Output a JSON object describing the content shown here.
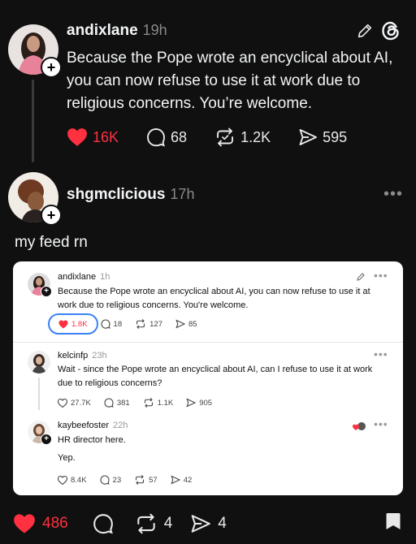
{
  "post1": {
    "username": "andixlane",
    "time": "19h",
    "text": "Because the Pope wrote an encyclical about AI, you can now refuse to use it at work due to religious concerns. You’re welcome.",
    "likes": "16K",
    "replies": "68",
    "reposts": "1.2K",
    "shares": "595"
  },
  "post2": {
    "username": "shgmclicious",
    "time": "17h",
    "text": "my feed rn"
  },
  "embed": {
    "post_a": {
      "username": "andixlane",
      "time": "1h",
      "text": "Because the Pope wrote an encyclical about AI, you can now refuse to use it at work due to religious concerns. You're welcome.",
      "likes": "1.8K",
      "replies": "18",
      "reposts": "127",
      "shares": "85"
    },
    "post_b": {
      "username": "kelcinfp",
      "time": "23h",
      "text": "Wait - since the Pope wrote an encyclical about AI, can I refuse to use it at work due to religious concerns?",
      "likes": "27.7K",
      "replies": "381",
      "reposts": "1.1K",
      "shares": "905"
    },
    "post_c": {
      "username": "kaybeefoster",
      "time": "22h",
      "line1": "HR director here.",
      "line2": "Yep.",
      "likes": "8.4K",
      "replies": "23",
      "reposts": "57",
      "shares": "42"
    }
  },
  "bottom_bar": {
    "likes": "486",
    "reposts": "4",
    "shares": "4"
  },
  "colors": {
    "like_red": "#ff3040",
    "background": "#101010",
    "highlight_blue": "#3b82f6"
  }
}
